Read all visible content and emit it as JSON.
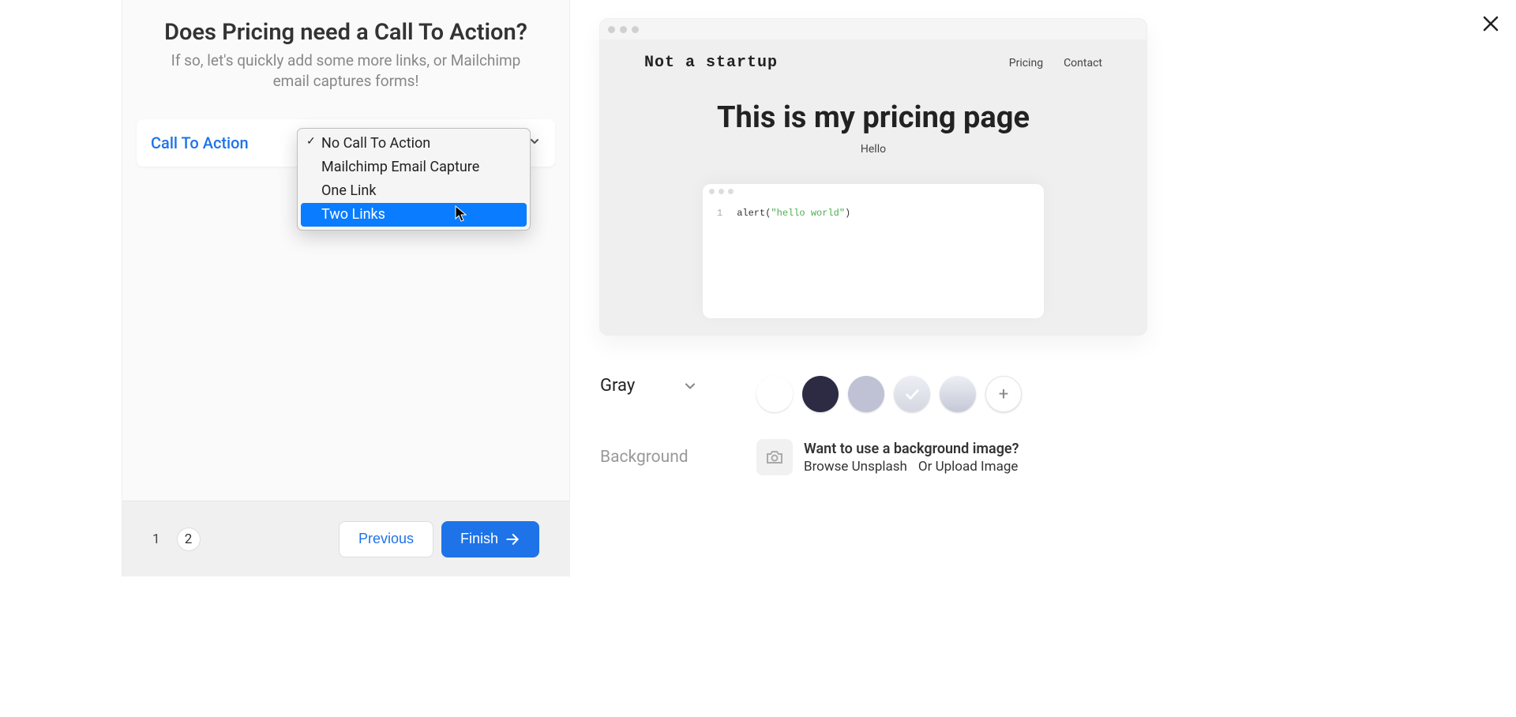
{
  "close_label": "Close",
  "wizard": {
    "title": "Does Pricing need a Call To Action?",
    "subtitle": "If so, let's quickly add some more links, or Mailchimp email captures forms!",
    "card_label": "Call To Action",
    "previous_label": "Previous",
    "finish_label": "Finish",
    "steps": [
      "1",
      "2"
    ],
    "current_step": 2
  },
  "dropdown": {
    "selected": "No Call To Action",
    "highlighted": "Two Links",
    "options": [
      "No Call To Action",
      "Mailchimp Email Capture",
      "One Link",
      "Two Links"
    ]
  },
  "preview": {
    "brand": "Not a startup",
    "nav": [
      "Pricing",
      "Contact"
    ],
    "hero_title": "This is my pricing page",
    "hero_sub": "Hello",
    "code_line_no": "1",
    "code_prefix": "alert(",
    "code_string": "\"hello world\"",
    "code_suffix": ")"
  },
  "palette": {
    "label": "Gray",
    "swatches": [
      "#ffffff",
      "#2d2a44",
      "#bfc2d4",
      "check",
      "gradient",
      "add"
    ]
  },
  "background": {
    "label": "Background",
    "question": "Want to use a background image?",
    "browse": "Browse Unsplash",
    "upload": "Or Upload Image"
  }
}
